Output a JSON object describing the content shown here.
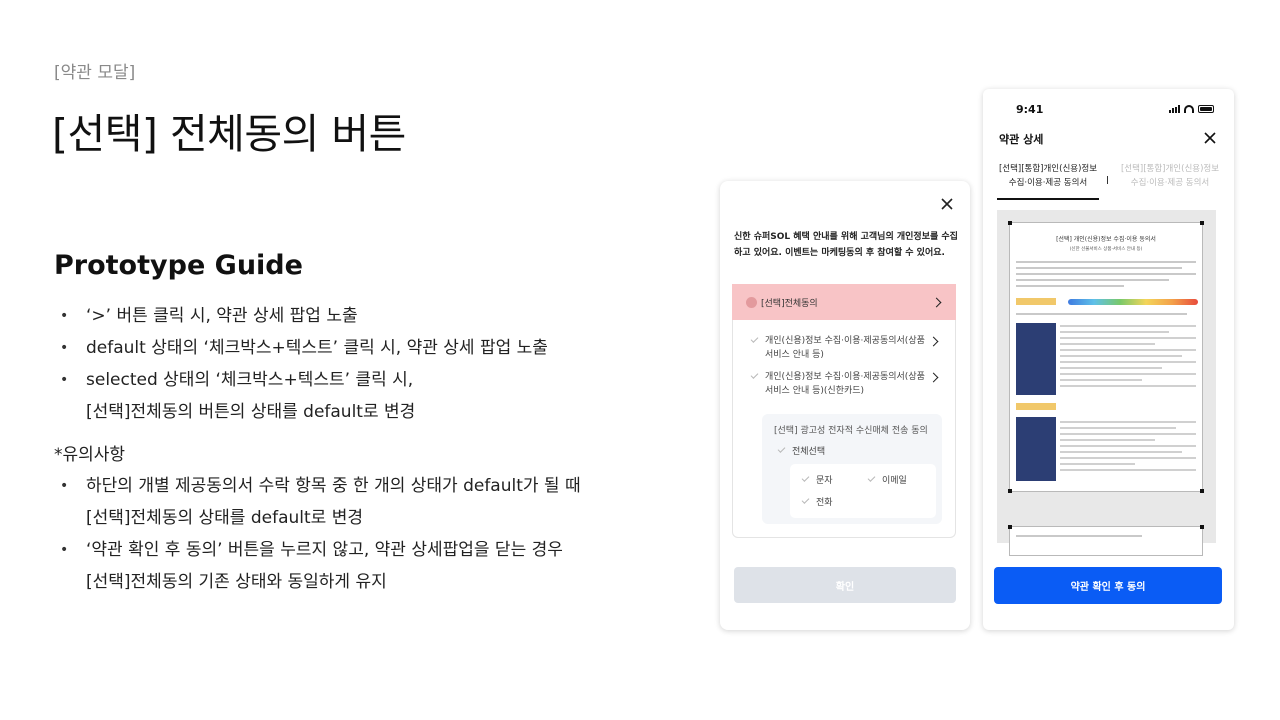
{
  "header": {
    "eyebrow": "[약관 모달]",
    "title": "[선택] 전체동의 버튼"
  },
  "guide": {
    "heading": "Prototype Guide",
    "bullets": [
      {
        "line1": "‘>’ 버튼 클릭 시, 약관 상세 팝업 노출",
        "line2": ""
      },
      {
        "line1": "default 상태의 ‘체크박스+텍스트’ 클릭 시, 약관 상세 팝업 노출",
        "line2": ""
      },
      {
        "line1": "selected 상태의 ‘체크박스+텍스트’ 클릭 시,",
        "line2": "[선택]전체동의 버튼의 상태를 default로 변경"
      }
    ]
  },
  "notes": {
    "heading": "*유의사항",
    "bullets": [
      {
        "line1": "하단의 개별 제공동의서 수락 항목 중 한 개의 상태가 default가 될 때",
        "line2": "[선택]전체동의 상태를 default로 변경"
      },
      {
        "line1": "‘약관 확인 후 동의’ 버튼을 누르지 않고, 약관 상세팝업을 닫는 경우",
        "line2": "[선택]전체동의 기존 상태와 동일하게 유지"
      }
    ]
  },
  "modal": {
    "intro": "신한 슈퍼SOL 혜택 안내를 위해 고객님의 개인정보를 수집하고 있어요. 이벤트는 마케팅동의 후 참여할 수 있어요.",
    "all_agree_label": "[선택]전체동의",
    "items": [
      {
        "label": "개인(신용)정보 수집·이용·제공동의서(상품서비스 안내 등)"
      },
      {
        "label": "개인(신용)정보 수집·이용·제공동의서(상품서비스 안내 등)(신한카드)"
      }
    ],
    "ad_section": {
      "title": "[선택] 광고성 전자적 수신매체 전송 동의",
      "select_all": "전체선택",
      "options": [
        "문자",
        "이메일",
        "전화"
      ]
    },
    "confirm_label": "확인",
    "colors": {
      "selected_bg": "#f8c4c6",
      "disabled_button": "#dee2e8"
    }
  },
  "detail": {
    "status_time": "9:41",
    "heading": "약관 상세",
    "tabs": [
      {
        "line1": "[선택][통합]개인(신용)정보",
        "line2": "수집·이용·제공 동의서",
        "active": true
      },
      {
        "line1": "[선택][통합]개인(신용)정보",
        "line2": "수집·이용·제공 동의서",
        "active": false
      }
    ],
    "document": {
      "title": "[선택] 개인(신용)정보 수집·이용 동의서",
      "subtitle": "(신한 선불서비스 상품·서비스 안내 등)"
    },
    "agree_button": "약관 확인 후 동의",
    "colors": {
      "primary": "#0a5cf5"
    }
  }
}
